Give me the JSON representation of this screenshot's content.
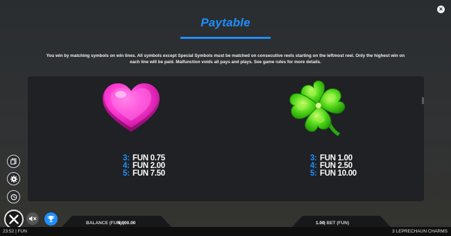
{
  "header": {
    "close_glyph": "×",
    "title": "Paytable"
  },
  "description": "You win by matching symbols on win lines. All symbols except Special Symbols must be matched on consecutive reels starting on the leftmost reel. Only the highest win on each line will be paid. Malfunction voids all pays and plays. See game rules for more details.",
  "symbols": [
    {
      "icon": "heart-icon",
      "pays": [
        {
          "count": "3:",
          "value": "FUN 0.75"
        },
        {
          "count": "4:",
          "value": "FUN 2.00"
        },
        {
          "count": "5:",
          "value": "FUN 7.50"
        }
      ]
    },
    {
      "icon": "clover-icon",
      "pays": [
        {
          "count": "3:",
          "value": "FUN 1.00"
        },
        {
          "count": "4:",
          "value": "FUN 2.50"
        },
        {
          "count": "5:",
          "value": "FUN 10.00"
        }
      ]
    }
  ],
  "side_buttons": [
    "paytable-icon",
    "settings-icon",
    "history-icon"
  ],
  "bottom": {
    "balance_label": "BALANCE (FUN) |",
    "balance_value": "5,000.00",
    "bet_value": "1.00",
    "bet_label": "| BET (FUN)"
  },
  "footer": {
    "time_currency": "23:52 | FUN",
    "game_name": "3 LEPRECHAUN CHARMS"
  },
  "colors": {
    "accent": "#1e8fff",
    "background": "#2e3032",
    "panel": "#1f2124"
  }
}
